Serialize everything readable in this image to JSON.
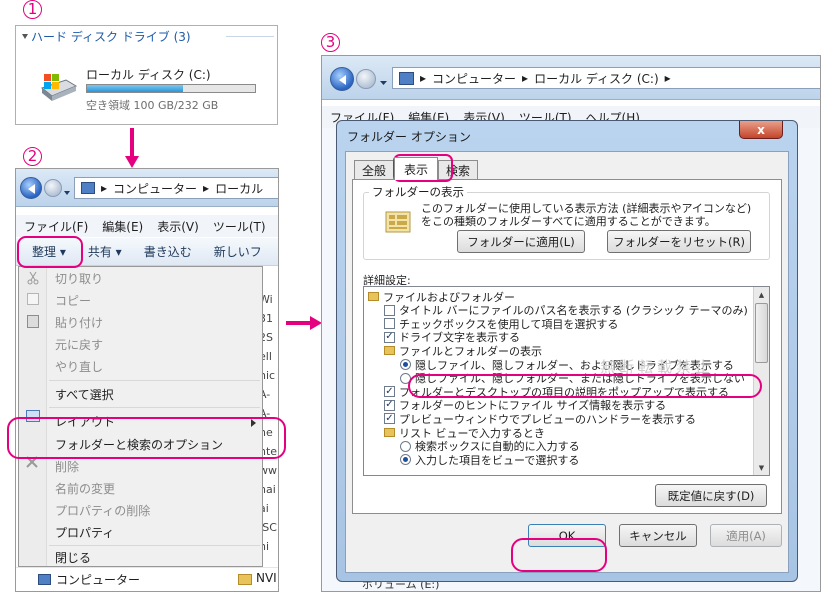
{
  "steps": [
    "1",
    "2",
    "3"
  ],
  "panel1": {
    "section_title": "ハード ディスク ドライブ (3)",
    "drive_name": "ローカル ディスク (C:)",
    "free_space": "空き領域 100 GB/232 GB",
    "used_fraction": 0.57
  },
  "panel2": {
    "address": {
      "seg1": "コンピューター",
      "seg2": "ローカル"
    },
    "menu": [
      "ファイル(F)",
      "編集(E)",
      "表示(V)",
      "ツール(T)"
    ],
    "toolbar": {
      "organize": "整理 ▾",
      "share": "共有 ▾",
      "burn": "書き込む",
      "new": "新しいフ"
    },
    "context_menu": [
      "切り取り",
      "コピー",
      "貼り付け",
      "元に戻す",
      "やり直し",
      "すべて選択",
      "レイアウト",
      "フォルダーと検索のオプション",
      "削除",
      "名前の変更",
      "プロパティの削除",
      "プロパティ",
      "閉じる"
    ],
    "bg_fragments": [
      "Wi",
      "31",
      "2S",
      "ell",
      "hic",
      "A-",
      "A-",
      "he",
      "nte",
      "ww",
      "hai",
      "ai",
      "ISC",
      "ni"
    ],
    "nav_computer": "コンピューター",
    "nav_nvi": "NVI"
  },
  "panel3": {
    "address": {
      "seg1": "コンピューター",
      "seg2": "ローカル ディスク (C:)"
    },
    "menu": [
      "ファイル(F)",
      "編集(E)",
      "表示(V)",
      "ツール(T)",
      "ヘルプ(H)"
    ],
    "dialog": {
      "title": "フォルダー オプション",
      "tabs": [
        "全般",
        "表示",
        "検索"
      ],
      "group_folder_view": "フォルダーの表示",
      "folder_view_desc_1": "このフォルダーに使用している表示方法 (詳細表示やアイコンなど)",
      "folder_view_desc_2": "をこの種類のフォルダーすべてに適用することができます。",
      "apply_folders": "フォルダーに適用(L)",
      "reset_folders": "フォルダーをリセット(R)",
      "advanced": "詳細設定:",
      "tree": [
        {
          "kind": "folder",
          "text": "ファイルおよびフォルダー",
          "indent": 0
        },
        {
          "kind": "check",
          "checked": false,
          "text": "タイトル バーにファイルのパス名を表示する (クラシック テーマのみ)",
          "indent": 1
        },
        {
          "kind": "check",
          "checked": false,
          "text": "チェックボックスを使用して項目を選択する",
          "indent": 1
        },
        {
          "kind": "check",
          "checked": true,
          "text": "ドライブ文字を表示する",
          "indent": 1
        },
        {
          "kind": "folder",
          "text": "ファイルとフォルダーの表示",
          "indent": 1
        },
        {
          "kind": "radio",
          "checked": true,
          "text": "隠しファイル、隠しフォルダー、および隠しドライブを表示する",
          "indent": 2
        },
        {
          "kind": "radio",
          "checked": false,
          "text": "隠しファイル、隠しフォルダー、または隠しドライブを表示しない",
          "indent": 2
        },
        {
          "kind": "check",
          "checked": true,
          "text": "フォルダーとデスクトップの項目の説明をポップアップで表示する",
          "indent": 1
        },
        {
          "kind": "check",
          "checked": true,
          "text": "フォルダーのヒントにファイル サイズ情報を表示する",
          "indent": 1
        },
        {
          "kind": "check",
          "checked": true,
          "text": "プレビューウィンドウでプレビューのハンドラーを表示する",
          "indent": 1
        },
        {
          "kind": "folder",
          "text": "リスト ビューで入力するとき",
          "indent": 1
        },
        {
          "kind": "radio",
          "checked": false,
          "text": "検索ボックスに自動的に入力する",
          "indent": 2
        },
        {
          "kind": "radio",
          "checked": true,
          "text": "入力した項目をビューで選択する",
          "indent": 2
        }
      ],
      "restore_defaults": "既定値に戻す(D)",
      "ok": "OK",
      "cancel": "キャンセル",
      "apply": "適用(A)",
      "close_glyph": "x"
    },
    "bottom_fragment": "ボリューム (E:)"
  },
  "watermark": "無断転載禁止",
  "colors": {
    "accent": "#e4007f",
    "link_blue": "#1e5aa8"
  }
}
